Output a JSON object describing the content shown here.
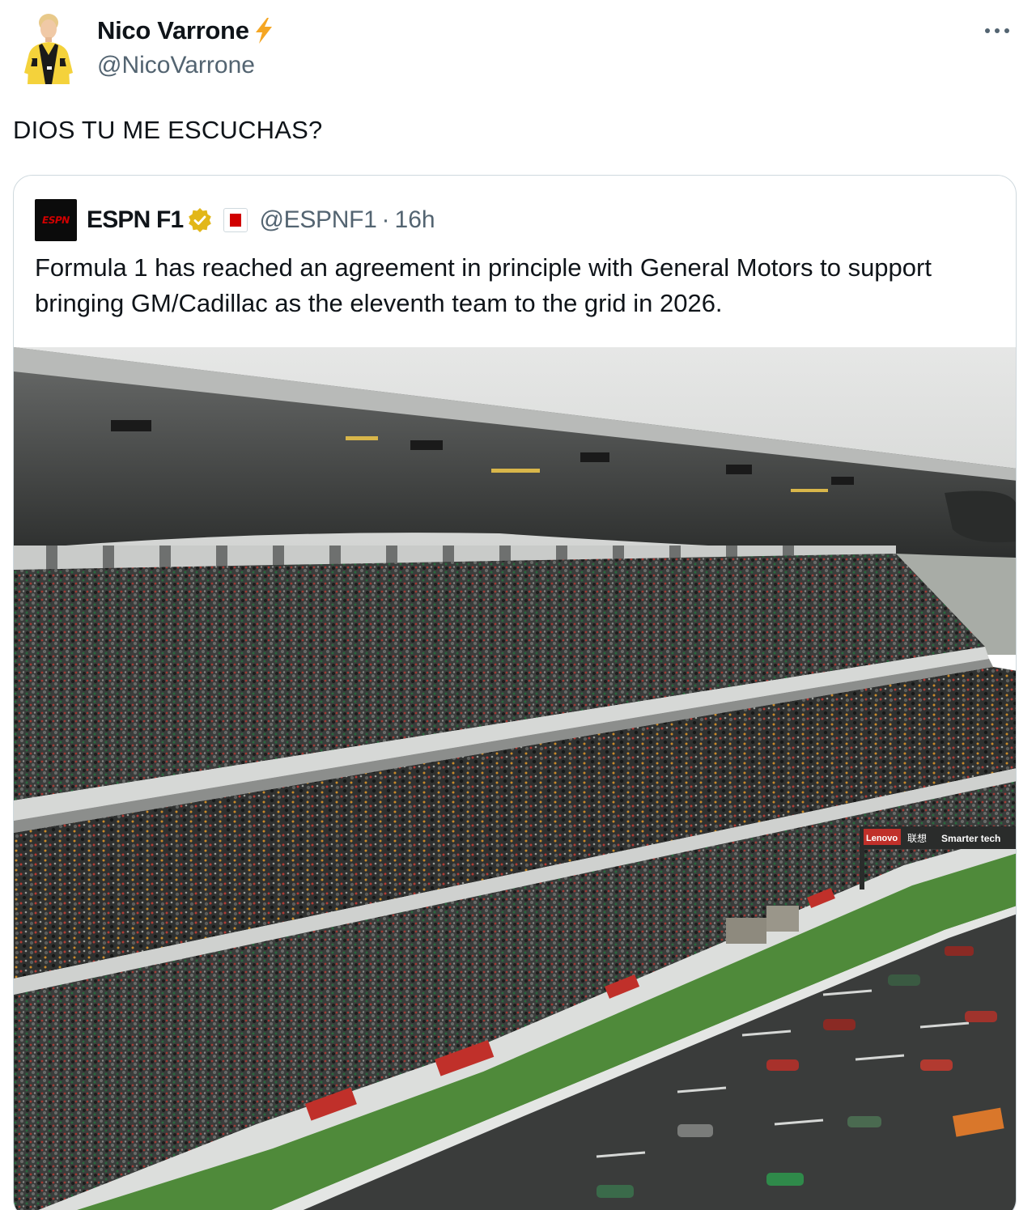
{
  "author": {
    "name": "Nico Varrone",
    "handle": "@NicoVarrone",
    "badge_icon": "lightning-bolt-icon",
    "badge_color": "#f5a623"
  },
  "tweet": {
    "text": "DIOS TU ME ESCUCHAS?"
  },
  "quote": {
    "name": "ESPN F1",
    "logo_text": "ESPN",
    "verified_color": "#e2b719",
    "handle": "@ESPNF1",
    "separator": "·",
    "time": "16h",
    "text": "Formula 1 has reached an agreement in principle with General Motors to support bringing GM/Cadillac as the eleventh team to the grid in 2026.",
    "media": {
      "banner_brand": "Lenovo",
      "banner_chinese": "联想",
      "banner_slogan": "Smarter tech"
    }
  },
  "colors": {
    "text_primary": "#0f1419",
    "text_secondary": "#536471",
    "border": "#cfd9de",
    "espn_red": "#d00000"
  }
}
